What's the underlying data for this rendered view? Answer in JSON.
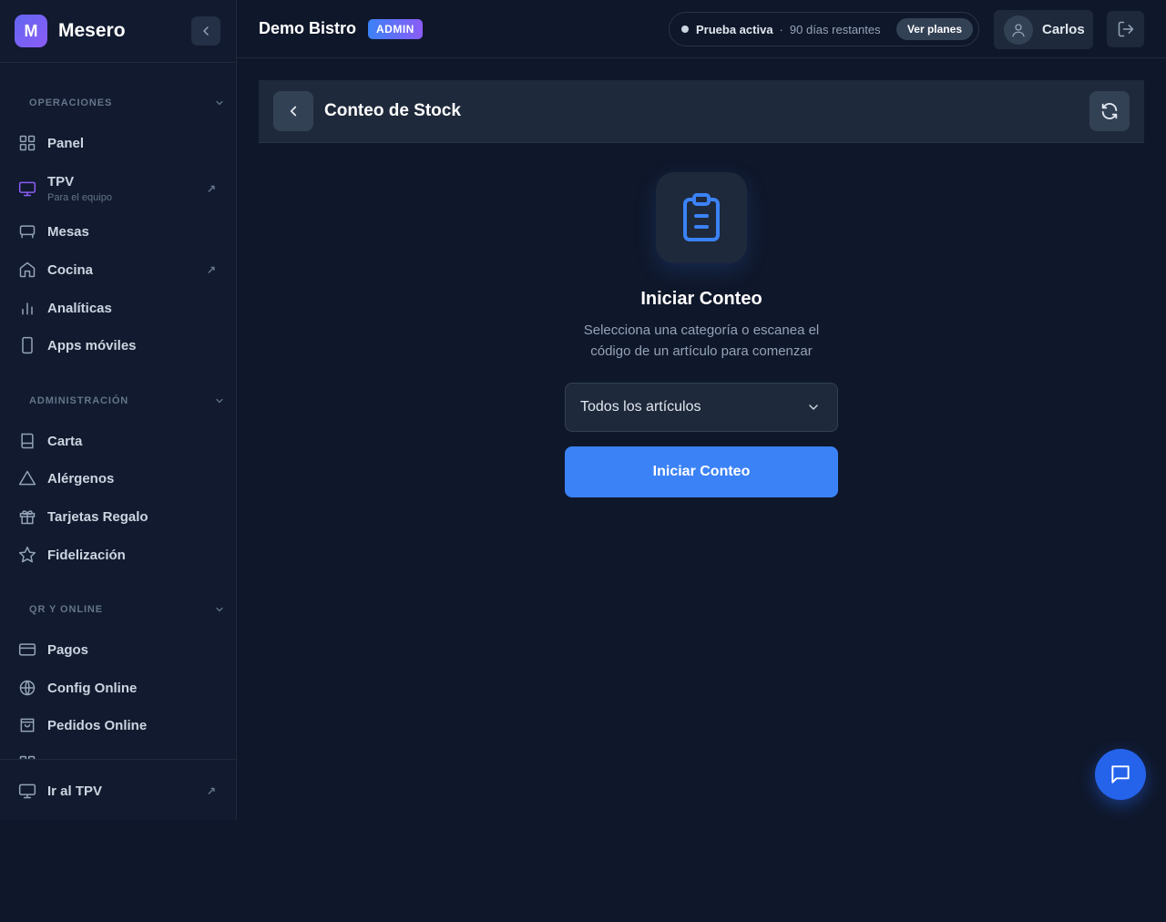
{
  "brand": {
    "logo_letter": "M",
    "name": "Mesero"
  },
  "sidebar": {
    "sections": [
      {
        "title": "OPERACIONES",
        "items": [
          {
            "label": "Panel",
            "icon": "grid-icon"
          },
          {
            "label": "TPV",
            "sub": "Para el equipo",
            "icon": "monitor-icon",
            "external": true
          },
          {
            "label": "Mesas",
            "icon": "table-icon"
          },
          {
            "label": "Cocina",
            "icon": "home-icon",
            "external": true
          },
          {
            "label": "Analíticas",
            "icon": "bar-chart-icon"
          },
          {
            "label": "Apps móviles",
            "icon": "phone-icon"
          }
        ]
      },
      {
        "title": "ADMINISTRACIÓN",
        "items": [
          {
            "label": "Carta",
            "icon": "book-icon"
          },
          {
            "label": "Alérgenos",
            "icon": "warning-icon"
          },
          {
            "label": "Tarjetas Regalo",
            "icon": "gift-icon"
          },
          {
            "label": "Fidelización",
            "icon": "star-icon"
          }
        ]
      },
      {
        "title": "QR Y ONLINE",
        "items": [
          {
            "label": "Pagos",
            "icon": "credit-card-icon"
          },
          {
            "label": "Config Online",
            "icon": "globe-icon"
          },
          {
            "label": "Pedidos Online",
            "icon": "shopping-bag-icon"
          }
        ]
      }
    ],
    "footer": {
      "label": "Ir al TPV",
      "icon": "monitor-icon"
    },
    "accent": "#8b5cf6"
  },
  "topbar": {
    "business_name": "Demo Bistro",
    "role_badge": "ADMIN",
    "trial_status": "Prueba activa",
    "separator": "·",
    "trial_remaining": "90 días restantes",
    "plans_button": "Ver planes",
    "user_name": "Carlos"
  },
  "page": {
    "title": "Conteo de Stock",
    "empty_title": "Iniciar Conteo",
    "empty_description": "Selecciona una categoría o escanea el código de un artículo para comenzar",
    "category_select_value": "Todos los artículos",
    "start_button": "Iniciar Conteo"
  },
  "colors": {
    "background": "#0f172a",
    "panel": "#1e293b",
    "primary": "#3b82f6",
    "badge_gradient_start": "#3b82f6",
    "badge_gradient_end": "#8b5cf6"
  }
}
